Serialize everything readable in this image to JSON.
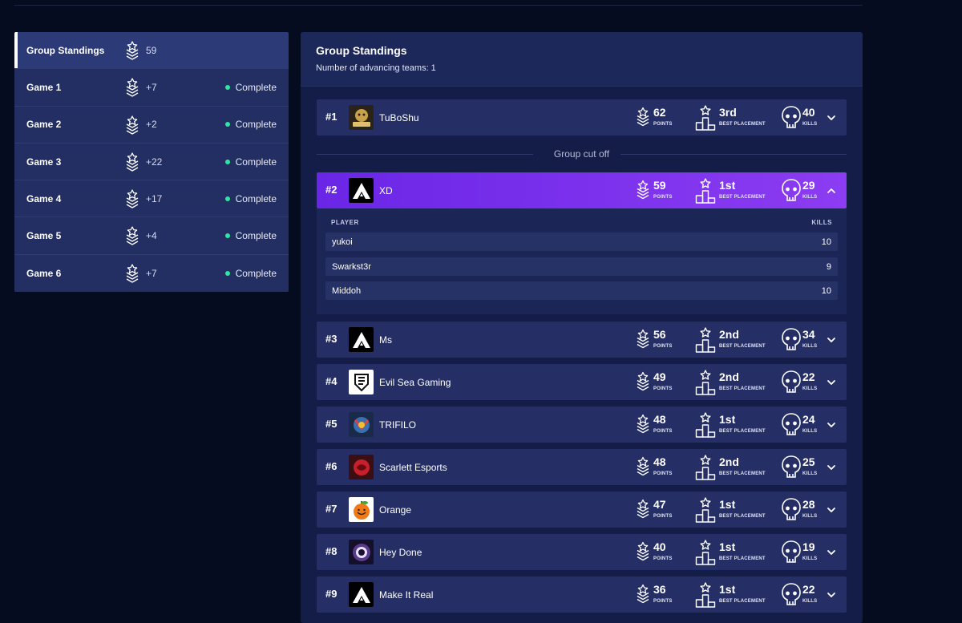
{
  "sidebar": {
    "items": [
      {
        "label": "Group Standings",
        "points": "59",
        "status": "",
        "active": true
      },
      {
        "label": "Game 1",
        "points": "+7",
        "status": "Complete",
        "active": false
      },
      {
        "label": "Game 2",
        "points": "+2",
        "status": "Complete",
        "active": false
      },
      {
        "label": "Game 3",
        "points": "+22",
        "status": "Complete",
        "active": false
      },
      {
        "label": "Game 4",
        "points": "+17",
        "status": "Complete",
        "active": false
      },
      {
        "label": "Game 5",
        "points": "+4",
        "status": "Complete",
        "active": false
      },
      {
        "label": "Game 6",
        "points": "+7",
        "status": "Complete",
        "active": false
      }
    ]
  },
  "main": {
    "title": "Group Standings",
    "advancing": "Number of advancing teams: 1",
    "cutoff_label": "Group cut off",
    "labels": {
      "points": "POINTS",
      "best": "BEST PLACEMENT",
      "kills": "KILLS"
    },
    "teams": [
      {
        "rank": "#1",
        "name": "TuBoShu",
        "points": "62",
        "best": "3rd",
        "kills": "40",
        "logo": "tuboshu-logo",
        "expanded": false
      },
      {
        "rank": "#2",
        "name": "XD",
        "points": "59",
        "best": "1st",
        "kills": "29",
        "logo": "apex-logo",
        "expanded": true
      },
      {
        "rank": "#3",
        "name": "Ms",
        "points": "56",
        "best": "2nd",
        "kills": "34",
        "logo": "apex-logo",
        "expanded": false
      },
      {
        "rank": "#4",
        "name": "Evil Sea Gaming",
        "points": "49",
        "best": "2nd",
        "kills": "22",
        "logo": "evil-sea-logo",
        "expanded": false
      },
      {
        "rank": "#5",
        "name": "TRIFILO",
        "points": "48",
        "best": "1st",
        "kills": "24",
        "logo": "trifilo-logo",
        "expanded": false
      },
      {
        "rank": "#6",
        "name": "Scarlett Esports",
        "points": "48",
        "best": "2nd",
        "kills": "25",
        "logo": "scarlett-logo",
        "expanded": false
      },
      {
        "rank": "#7",
        "name": "Orange",
        "points": "47",
        "best": "1st",
        "kills": "28",
        "logo": "orange-logo",
        "expanded": false
      },
      {
        "rank": "#8",
        "name": "Hey Done",
        "points": "40",
        "best": "1st",
        "kills": "19",
        "logo": "hey-done-logo",
        "expanded": false
      },
      {
        "rank": "#9",
        "name": "Make It Real",
        "points": "36",
        "best": "1st",
        "kills": "22",
        "logo": "apex-logo",
        "expanded": false
      }
    ],
    "expanded_players": {
      "header_player": "PLAYER",
      "header_kills": "KILLS",
      "players": [
        {
          "name": "yukoi",
          "kills": "10"
        },
        {
          "name": "Swarkst3r",
          "kills": "9"
        },
        {
          "name": "Middoh",
          "kills": "10"
        }
      ]
    }
  },
  "colors": {
    "background": "#060c1f",
    "panel": "#141d48",
    "row": "#252f66",
    "highlight_start": "#6a26e6",
    "highlight_end": "#8c3cf2",
    "status_dot": "#2ee6a0"
  }
}
